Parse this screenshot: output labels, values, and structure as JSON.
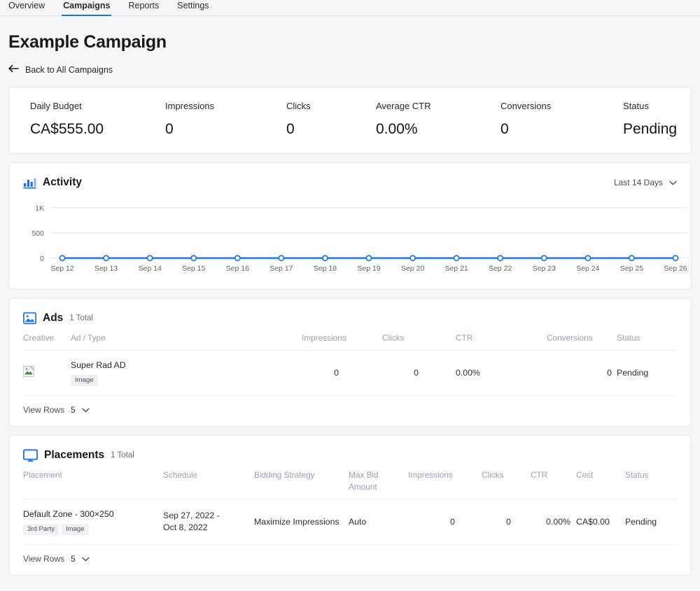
{
  "nav": {
    "items": [
      {
        "label": "Overview",
        "active": false
      },
      {
        "label": "Campaigns",
        "active": true
      },
      {
        "label": "Reports",
        "active": false
      },
      {
        "label": "Settings",
        "active": false
      }
    ]
  },
  "header": {
    "title": "Example Campaign",
    "back_label": "Back to All Campaigns",
    "back_icon": "arrow-left-icon"
  },
  "stats": [
    {
      "label": "Daily Budget",
      "value": "CA$555.00"
    },
    {
      "label": "Impressions",
      "value": "0"
    },
    {
      "label": "Clicks",
      "value": "0"
    },
    {
      "label": "Average CTR",
      "value": "0.00%"
    },
    {
      "label": "Conversions",
      "value": "0"
    },
    {
      "label": "Status",
      "value": "Pending"
    }
  ],
  "activity": {
    "title": "Activity",
    "icon": "bar-chart-icon",
    "range_label": "Last 14 Days",
    "range_icon": "chevron-down-icon"
  },
  "chart_data": {
    "type": "line",
    "title": "Activity",
    "xlabel": "",
    "ylabel": "",
    "x": [
      "Sep 12",
      "Sep 13",
      "Sep 14",
      "Sep 15",
      "Sep 16",
      "Sep 17",
      "Sep 18",
      "Sep 19",
      "Sep 20",
      "Sep 21",
      "Sep 22",
      "Sep 23",
      "Sep 24",
      "Sep 25",
      "Sep 26"
    ],
    "series": [
      {
        "name": "Impressions",
        "values": [
          0,
          0,
          0,
          0,
          0,
          0,
          0,
          0,
          0,
          0,
          0,
          0,
          0,
          0,
          0
        ],
        "color": "#1a73e8"
      }
    ],
    "yticks": [
      0,
      500,
      1000
    ],
    "ytick_labels": [
      "0",
      "500",
      "1K"
    ],
    "ylim": [
      0,
      1000
    ],
    "grid": true,
    "legend": "none",
    "markers": true
  },
  "ads": {
    "title": "Ads",
    "icon": "image-icon",
    "count_label": "1 Total",
    "columns": [
      "Creative",
      "Ad / Type",
      "Impressions",
      "Clicks",
      "CTR",
      "Conversions",
      "Status"
    ],
    "rows": [
      {
        "creative_icon": "broken-image-icon",
        "name": "Super Rad AD",
        "type_chip": "Image",
        "impressions": "0",
        "clicks": "0",
        "ctr": "0.00%",
        "conversions": "0",
        "status": "Pending"
      }
    ],
    "view_rows_label": "View Rows",
    "view_rows_count": "5",
    "view_rows_icon": "chevron-down-icon"
  },
  "placements": {
    "title": "Placements",
    "icon": "monitor-icon",
    "count_label": "1 Total",
    "columns": [
      "Placement",
      "Schedule",
      "Bidding Strategy",
      "Max Bid Amount",
      "Impressions",
      "Clicks",
      "CTR",
      "Cost",
      "Status"
    ],
    "rows": [
      {
        "placement": "Default Zone - 300×250",
        "chips": [
          "3rd Party",
          "Image"
        ],
        "schedule_line1": "Sep 27, 2022 -",
        "schedule_line2": "Oct 8, 2022",
        "bidding_strategy": "Maximize Impressions",
        "max_bid": "Auto",
        "impressions": "0",
        "clicks": "0",
        "ctr": "0.00%",
        "cost": "CA$0.00",
        "status": "Pending"
      }
    ],
    "view_rows_label": "View Rows",
    "view_rows_count": "5",
    "view_rows_icon": "chevron-down-icon"
  },
  "colors": {
    "accent": "#1a73e8",
    "page_bg": "#f5f6f8",
    "card_bg": "#ffffff",
    "header_text": "#9aa0b4"
  }
}
